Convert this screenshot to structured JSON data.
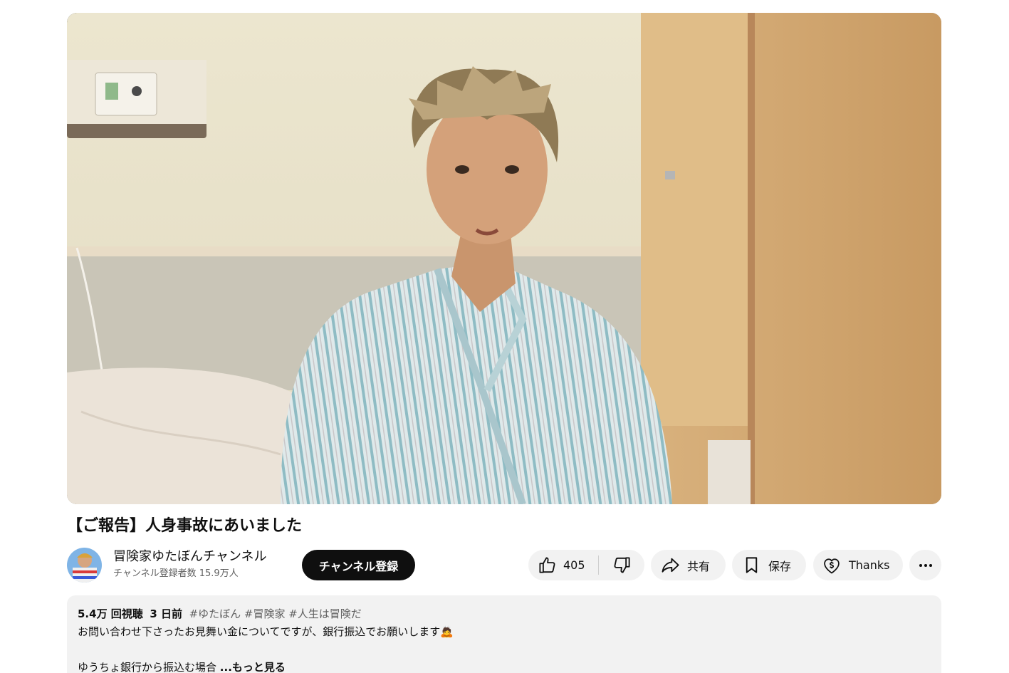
{
  "video": {
    "title": "【ご報告】人身事故にあいました"
  },
  "channel": {
    "name": "冒険家ゆたぼんチャンネル",
    "subscribers": "チャンネル登録者数 15.9万人",
    "subscribe_label": "チャンネル登録"
  },
  "actions": {
    "like_count": "405",
    "share_label": "共有",
    "save_label": "保存",
    "thanks_label": "Thanks"
  },
  "description": {
    "views": "5.4万 回視聴",
    "date": "3 日前",
    "hashtags": "#ゆたぼん #冒険家 #人生は冒険だ",
    "line1": "お問い合わせ下さったお見舞い金についてですが、銀行振込でお願いします🙇",
    "line2": "ゆうちょ銀行から振込む場合",
    "more_label": "...もっと見る"
  },
  "icons": {
    "like": "thumbs-up-icon",
    "dislike": "thumbs-down-icon",
    "share": "share-arrow-icon",
    "save": "bookmark-icon",
    "thanks": "heart-dollar-icon",
    "more": "more-horizontal-icon"
  },
  "colors": {
    "subscribe_bg": "#0f0f0f",
    "pill_bg": "#f2f2f2",
    "secondary_text": "#606060"
  }
}
